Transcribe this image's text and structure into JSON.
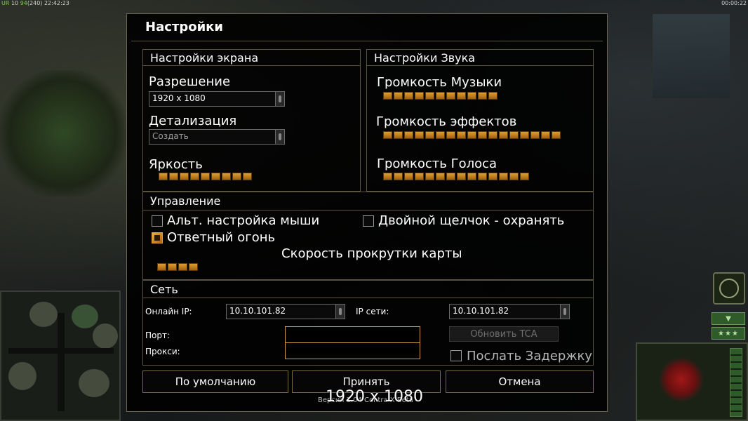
{
  "hud": {
    "left_tag": "UR",
    "left_fps": "10",
    "left_fps2": "94",
    "left_bracket": "(240)",
    "left_time": "22:42:23",
    "right_time": "00:00:22"
  },
  "dialog": {
    "title": "Настройки",
    "screen": {
      "header": "Настройки экрана",
      "resolution_label": "Разрешение",
      "resolution_value": "1920 x 1080",
      "detail_label": "Детализация",
      "detail_value": "Создать",
      "brightness_label": "Яркость",
      "brightness_level": 9
    },
    "sound": {
      "header": "Настройки Звука",
      "music_label": "Громкость Музыки",
      "music_level": 11,
      "effects_label": "Громкость эффектов",
      "effects_level": 17,
      "voice_label": "Громкость Голоса",
      "voice_level": 14
    },
    "control": {
      "header": "Управление",
      "alt_mouse_label": "Альт. настройка мыши",
      "alt_mouse_checked": false,
      "double_click_label": "Двойной щелчок - охранять",
      "double_click_checked": false,
      "return_fire_label": "Ответный огонь",
      "return_fire_checked": true,
      "scroll_speed_label": "Скорость прокрутки карты",
      "scroll_speed_level": 4
    },
    "network": {
      "header": "Сеть",
      "online_ip_label": "Онлайн IP:",
      "online_ip_value": "10.10.101.82",
      "lan_ip_label": "IP сети:",
      "lan_ip_value": "10.10.101.82",
      "port_label": "Порт:",
      "proxy_label": "Прокси:",
      "update_button": "Обновить TCA",
      "send_delay_label": "Послать Задержку",
      "send_delay_checked": false
    },
    "buttons": {
      "defaults": "По умолчанию",
      "accept": "Принять",
      "cancel": "Отмена"
    },
    "version": "Версия 1.04 Contra X Beta",
    "resolution_overlay": "1920 x 1080"
  },
  "side": {
    "arrow_icon": "chevron-down-icon",
    "stars": "★★★"
  },
  "colors": {
    "accent": "#e0a030",
    "border": "#5a5440",
    "input_border": "#c8a040"
  }
}
